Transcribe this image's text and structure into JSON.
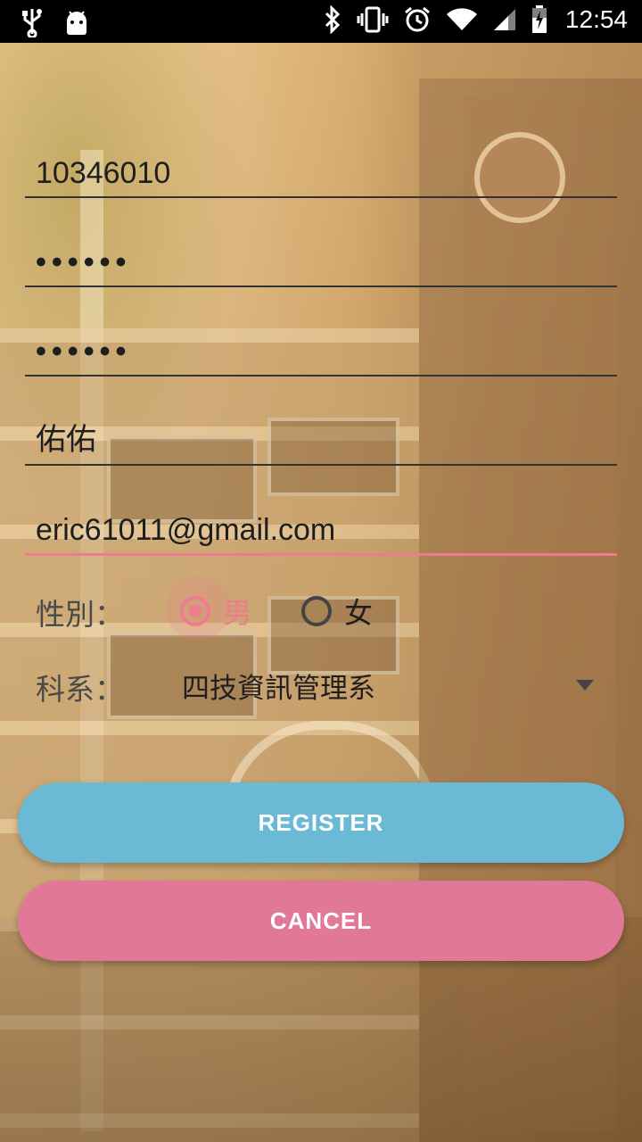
{
  "status_bar": {
    "time": "12:54",
    "icons_left": [
      "usb-icon",
      "android-debug-icon"
    ],
    "icons_right": [
      "bluetooth-icon",
      "vibrate-icon",
      "alarm-icon",
      "wifi-icon",
      "signal-icon",
      "battery-charging-icon"
    ]
  },
  "form": {
    "student_id": "10346010",
    "password": "••••••",
    "confirm_password": "••••••",
    "name": "佑佑",
    "email": "eric61011@gmail.com",
    "gender_label": "性別：",
    "gender_options": [
      "男",
      "女"
    ],
    "gender_selected": "男",
    "department_label": "科系：",
    "department_selected": "四技資訊管理系"
  },
  "buttons": {
    "register": "REGISTER",
    "cancel": "CANCEL"
  },
  "colors": {
    "accent": "#ef7c8e",
    "register_button": "#6ab9d5",
    "cancel_button": "#e27897"
  }
}
